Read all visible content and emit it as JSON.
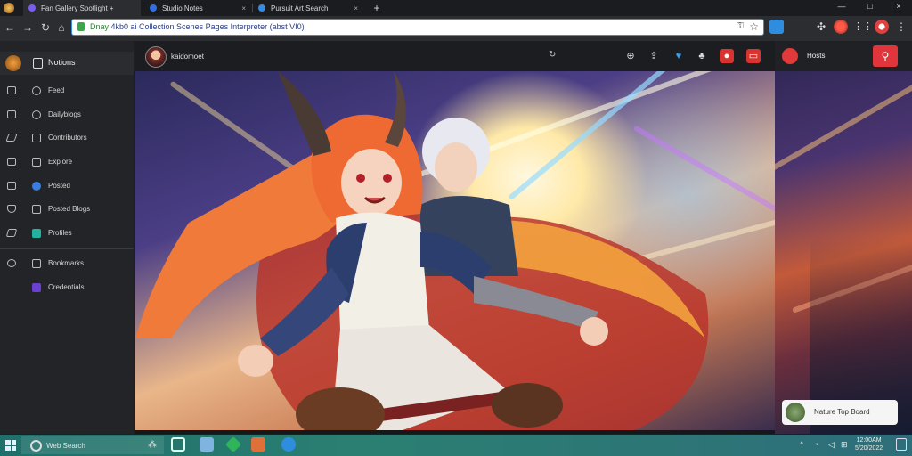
{
  "tabs": [
    {
      "title": "Fan Gallery Spotlight +",
      "icon": "purple-logo-icon",
      "active": true
    },
    {
      "title": "Studio Notes",
      "icon": "shield-icon",
      "active": false
    },
    {
      "title": "Pursuit Art Search",
      "icon": "star-icon",
      "active": false
    }
  ],
  "tab_close": "×",
  "new_tab": "+",
  "window": {
    "minimize": "—",
    "maximize": "□",
    "close": "×"
  },
  "nav": {
    "back": "←",
    "forward": "→",
    "reload": "↻"
  },
  "address": {
    "host": "Dnay",
    "rest": " 4kb0 ai Collection Scenes Pages Interpreter (abst VI0)"
  },
  "sidebar": {
    "header": "Notions",
    "items": [
      {
        "label": "Feed",
        "left_icon": "monitor-icon",
        "right_icon": "globe-icon"
      },
      {
        "label": "Dailyblogs",
        "left_icon": "news-icon",
        "right_icon": "clock-icon"
      },
      {
        "label": "Contributors",
        "left_icon": "pen-icon",
        "right_icon": "document-icon"
      },
      {
        "label": "Explore",
        "left_icon": "home-icon",
        "right_icon": "document-icon"
      },
      {
        "label": "Posted",
        "left_icon": "image-icon",
        "right_icon": "shield-icon"
      },
      {
        "label": "Posted Blogs",
        "left_icon": "shield-outline-icon",
        "right_icon": "document-icon"
      },
      {
        "label": "Profiles",
        "left_icon": "tag-icon",
        "right_icon": "teal-square-icon"
      },
      {
        "label": "Bookmarks",
        "left_icon": "settings-icon",
        "right_icon": "document-icon"
      },
      {
        "label": "Credentials",
        "left_icon": "",
        "right_icon": "purple-square-icon"
      }
    ]
  },
  "viewer": {
    "username": "kaidomoet",
    "reload": "↻",
    "toolbar_icons": [
      "zoom-icon",
      "share-icon",
      "heart-icon",
      "bell-icon",
      "record-icon",
      "fullscreen-icon"
    ]
  },
  "right_panel": {
    "label": "Hosts",
    "toast": "Nature Top Board",
    "button_icon": "user-icon"
  },
  "taskbar": {
    "search_placeholder": "Web Search",
    "clock_line1": "12:00AM",
    "clock_line2": "5/20/2022"
  },
  "colors": {
    "accent_red": "#e0353a",
    "taskbar": "#2b7f72",
    "link_green": "#2e7d32"
  }
}
